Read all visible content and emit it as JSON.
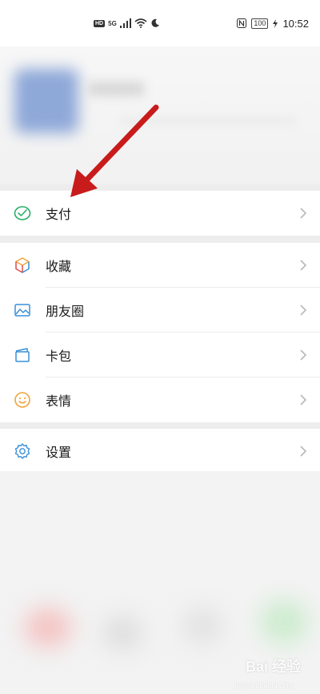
{
  "status_bar": {
    "hd_badge": "HD",
    "signal_label": "5G",
    "battery": "100",
    "time": "10:52"
  },
  "menu": {
    "pay": {
      "label": "支付",
      "icon": "wallet-check-icon"
    },
    "favorites": {
      "label": "收藏",
      "icon": "cube-icon"
    },
    "moments": {
      "label": "朋友圈",
      "icon": "photo-icon"
    },
    "cards": {
      "label": "卡包",
      "icon": "card-wallet-icon"
    },
    "stickers": {
      "label": "表情",
      "icon": "smile-icon"
    },
    "settings": {
      "label": "设置",
      "icon": "gear-icon"
    }
  },
  "watermark": {
    "text": "Bai 经验",
    "sub": "jingyan.baidu.com"
  },
  "colors": {
    "pay_icon": "#2aae67",
    "settings_icon": "#3a8fd8",
    "sticker_icon": "#f0a53a",
    "arrow": "#c81b1b",
    "chevron": "#b8b8b8",
    "separator": "#ededed"
  }
}
